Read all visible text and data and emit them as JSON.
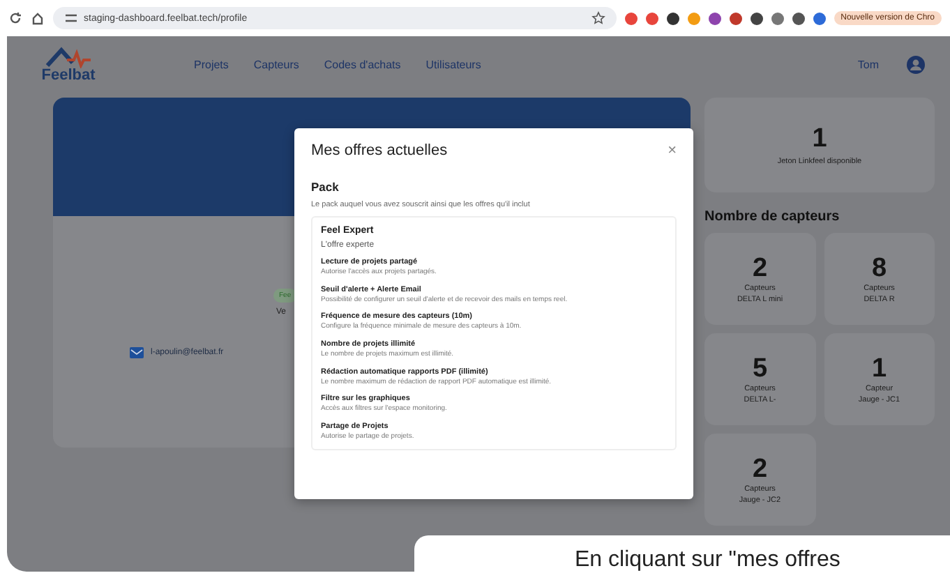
{
  "browser": {
    "url": "staging-dashboard.feelbat.tech/profile",
    "update_badge": "Nouvelle version de Chro"
  },
  "nav": {
    "logo": "Feelbat",
    "links": [
      "Projets",
      "Capteurs",
      "Codes d'achats",
      "Utilisateurs"
    ],
    "user": "Tom"
  },
  "profile": {
    "badge": "Fee",
    "partial_text": "Ve",
    "email": "l-apoulin@feelbat.fr"
  },
  "tokens": {
    "count": "1",
    "label": "Jeton Linkfeel disponible"
  },
  "sensors": {
    "title": "Nombre de capteurs",
    "cards": [
      {
        "count": "2",
        "unit": "Capteurs",
        "model": "DELTA L mini"
      },
      {
        "count": "8",
        "unit": "Capteurs",
        "model": "DELTA R"
      },
      {
        "count": "5",
        "unit": "Capteurs",
        "model": "DELTA L-"
      },
      {
        "count": "1",
        "unit": "Capteur",
        "model": "Jauge - JC1"
      },
      {
        "count": "2",
        "unit": "Capteurs",
        "model": "Jauge - JC2"
      }
    ]
  },
  "modal": {
    "title": "Mes offres actuelles",
    "close": "×",
    "section": "Pack",
    "description": "Le pack auquel vous avez souscrit ainsi que les offres qu'il inclut",
    "pack_name": "Feel Expert",
    "pack_subtitle": "L'offre experte",
    "offers": [
      {
        "name": "Lecture de projets partagé",
        "detail": "Autorise l'accès aux projets partagés."
      },
      {
        "name": "Seuil d'alerte + Alerte Email",
        "detail": "Possibilité de configurer un seuil d'alerte et de recevoir des mails en temps reel."
      },
      {
        "name": "Fréquence de mesure des capteurs (10m)",
        "detail": "Configure la fréquence minimale de mesure des capteurs à 10m."
      },
      {
        "name": "Nombre de projets illimité",
        "detail": "Le nombre de projets maximum est illimité."
      },
      {
        "name": "Rédaction automatique rapports PDF (illimité)",
        "detail": "Le nombre maximum de rédaction de rapport PDF automatique est illimité."
      },
      {
        "name": "Filtre sur les graphiques",
        "detail": "Accès aux filtres sur l'espace monitoring."
      },
      {
        "name": "Partage de Projets",
        "detail": "Autorise le partage de projets."
      }
    ]
  },
  "caption": "En cliquant sur \"mes offres"
}
